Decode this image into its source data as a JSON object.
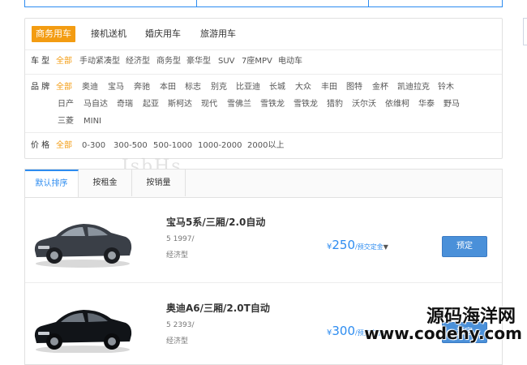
{
  "categories": [
    {
      "label": "商务用车",
      "active": true
    },
    {
      "label": "接机送机",
      "active": false
    },
    {
      "label": "婚庆用车",
      "active": false
    },
    {
      "label": "旅游用车",
      "active": false
    }
  ],
  "filters": {
    "car_type": {
      "label": "车 型",
      "options": [
        "全部",
        "手动紧凑型",
        "经济型",
        "商务型",
        "豪华型",
        "SUV",
        "7座MPV",
        "电动车"
      ]
    },
    "brand": {
      "label": "品 牌",
      "row1": [
        "全部",
        "奥迪",
        "宝马",
        "奔驰",
        "本田",
        "标志",
        "别克",
        "比亚迪",
        "长城",
        "大众",
        "丰田",
        "图特",
        "金杯",
        "凯迪拉克",
        "铃木"
      ],
      "row2": [
        "日产",
        "马自达",
        "奇瑞",
        "起亚",
        "斯柯达",
        "现代",
        "雪佛兰",
        "雪铁龙",
        "雪铁龙",
        "猎豹",
        "沃尔沃",
        "依维柯",
        "华泰",
        "野马"
      ],
      "row3": [
        "三菱",
        "MINI"
      ]
    },
    "price": {
      "label": "价 格",
      "options": [
        "全部",
        "0-300",
        "300-500",
        "500-1000",
        "1000-2000",
        "2000以上"
      ]
    }
  },
  "sort_tabs": [
    {
      "label": "默认排序",
      "active": true
    },
    {
      "label": "按租金",
      "active": false
    },
    {
      "label": "按销量",
      "active": false
    }
  ],
  "faint_text": "IsbHs",
  "cars": [
    {
      "name": "宝马5系/三厢/2.0自动",
      "spec1": "5 1997/",
      "spec2": "经济型",
      "currency": "¥",
      "price": "250",
      "price_unit": "/预交定金",
      "book_label": "预定",
      "body_color": "#3a3f47"
    },
    {
      "name": "奥迪A6/三厢/2.0T自动",
      "spec1": "5 2393/",
      "spec2": "经济型",
      "currency": "¥",
      "price": "300",
      "price_unit": "/预交定金",
      "book_label": "预定",
      "body_color": "#111418"
    }
  ],
  "watermark": {
    "line1": "源码海洋网",
    "line2": "www.codehy.com"
  },
  "colors": {
    "accent": "#f39c12",
    "primary": "#2d8cf0",
    "button": "#4a90d9"
  }
}
